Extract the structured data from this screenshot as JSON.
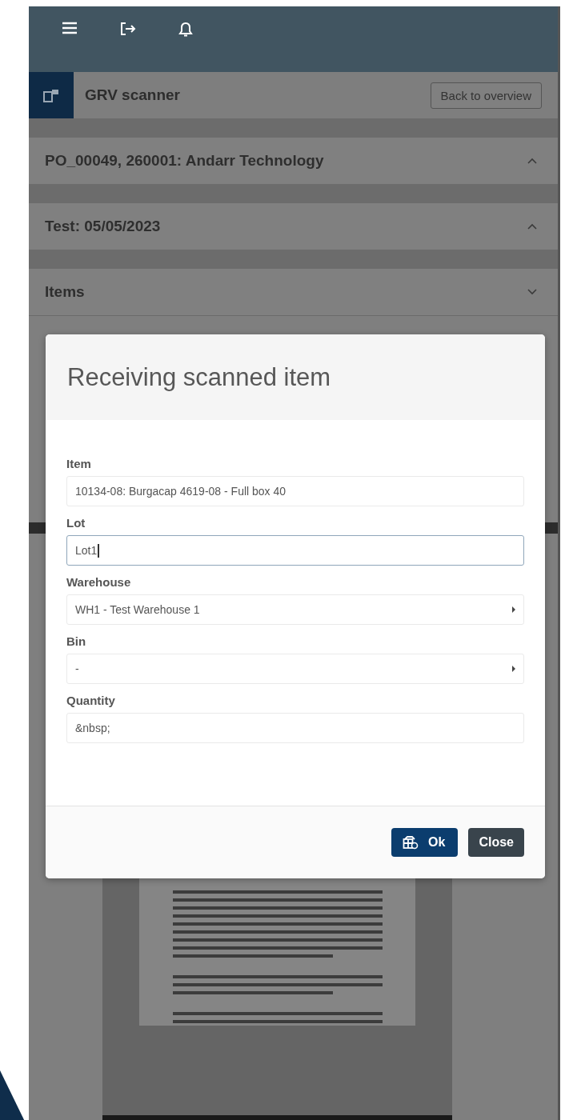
{
  "page_header": {
    "title": "GRV scanner",
    "back_button": "Back to overview"
  },
  "sections": [
    {
      "title": "PO_00049, 260001: Andarr Technology",
      "expanded": true
    },
    {
      "title": "Test: 05/05/2023",
      "expanded": true
    },
    {
      "title": "Items",
      "expanded": false
    }
  ],
  "modal": {
    "title": "Receiving scanned item",
    "fields": [
      {
        "label": "Item",
        "kind": "text",
        "value": "10134-08: Burgacap 4619-08 - Full box 40",
        "focused": false
      },
      {
        "label": "Lot",
        "kind": "text",
        "value": "Lot1",
        "focused": true
      },
      {
        "label": "Warehouse",
        "kind": "select",
        "value": "WH1 - Test Warehouse 1",
        "focused": false
      },
      {
        "label": "Bin",
        "kind": "select",
        "value": "-",
        "focused": false
      },
      {
        "label": "Quantity",
        "kind": "text",
        "value": "&nbsp;",
        "focused": false
      }
    ],
    "buttons": [
      {
        "label": "Ok",
        "kind": "primary"
      },
      {
        "label": "Close",
        "kind": "secondary"
      }
    ]
  }
}
